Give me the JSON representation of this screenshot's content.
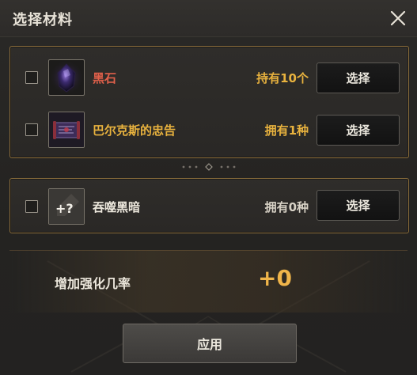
{
  "dialog": {
    "title": "选择材料",
    "close_icon": "close-icon"
  },
  "materials": [
    {
      "name": "黑石",
      "name_color": "#e0604a",
      "owned": "持有10个",
      "button": "选择",
      "checked": false,
      "icon": "black-stone-icon"
    },
    {
      "name": "巴尔克斯的忠告",
      "name_color": "#e8b23e",
      "owned": "拥有1种",
      "button": "选择",
      "checked": false,
      "icon": "scroll-icon"
    }
  ],
  "extra_material": {
    "name": "吞噬黑暗",
    "name_color": "#ece7dc",
    "owned": "拥有0种",
    "button": "选择",
    "checked": false,
    "icon": "unknown-item-icon",
    "icon_text": "+?"
  },
  "enhance": {
    "label": "增加强化几率",
    "value": "+0"
  },
  "apply_button": "应用",
  "colors": {
    "accent_gold": "#f0b54a",
    "panel_border": "#8a6d3b"
  }
}
